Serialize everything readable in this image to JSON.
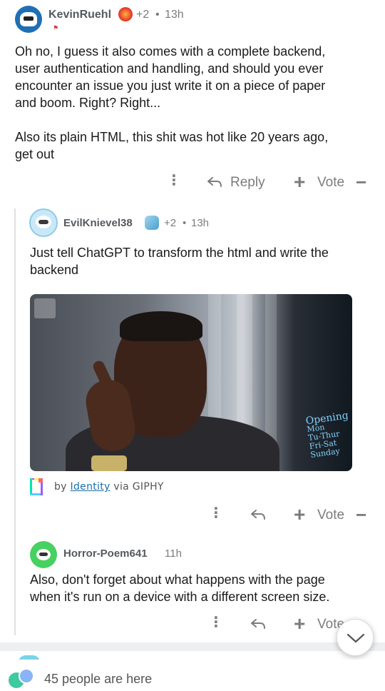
{
  "comments": [
    {
      "username": "KevinRuehl",
      "score": "+2",
      "separator": "•",
      "time": "13h",
      "body_lines": [
        "Oh no, I guess it also comes with a complete backend,",
        "user authentication and handling, and should you ever",
        "encounter an issue you just write it on a piece of paper",
        "and boom. Right? Right...",
        "",
        "Also its plain HTML, this shit was hot like 20 years ago,",
        "get out"
      ],
      "actions": {
        "reply_label": "Reply",
        "vote_label": "Vote"
      }
    },
    {
      "username": "EvilKnievel38",
      "score": "+2",
      "separator": "•",
      "time": "13h",
      "body_lines": [
        "Just tell ChatGPT to transform the html and write the",
        "backend"
      ],
      "gif": {
        "sign_lines": [
          "Opening",
          "Mon",
          "Tu-Thur",
          "Fri-Sat",
          "Sunday"
        ],
        "attribution_by": "by",
        "attribution_user": "Identity",
        "attribution_via": "via GIPHY"
      },
      "actions": {
        "vote_label": "Vote"
      }
    },
    {
      "username": "Horror-Poem641",
      "time": "11h",
      "body_lines": [
        "Also, don't forget about what happens with the page",
        "when it's run on a device with a different screen size."
      ],
      "actions": {
        "vote_label": "Vote"
      }
    }
  ],
  "icons": {
    "more": "more-options-icon",
    "reply": "reply-arrow-icon",
    "upvote": "plus-upvote-icon",
    "downvote": "minus-downvote-icon",
    "scroll": "chevron-down-icon"
  },
  "presence": {
    "text": "45 people are here"
  },
  "colors": {
    "username": "#555a5f",
    "meta": "#7c7c7c",
    "link": "#1b6fa8",
    "avatar_green": "#46d160",
    "avatar_blue": "#1f6fb5"
  }
}
